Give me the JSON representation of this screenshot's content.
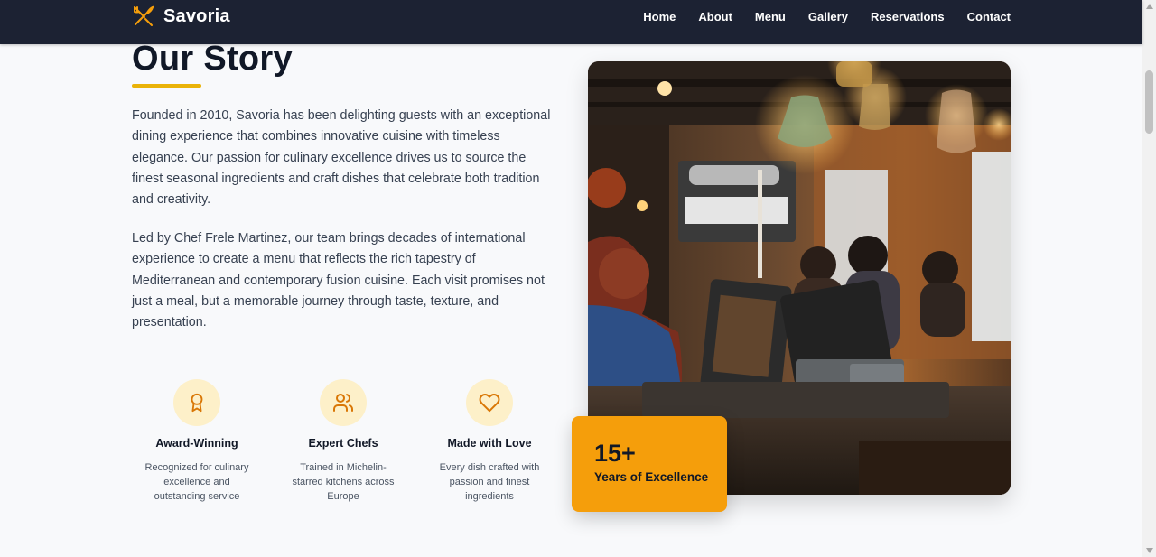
{
  "brand": {
    "name": "Savoria",
    "logo_icon": "utensils-crossed-icon",
    "accent_color": "#f59e0b"
  },
  "nav": {
    "links": [
      "Home",
      "About",
      "Menu",
      "Gallery",
      "Reservations",
      "Contact"
    ]
  },
  "story": {
    "title": "Our Story",
    "paragraphs": [
      "Founded in 2010, Savoria has been delighting guests with an exceptional dining experience that combines innovative cuisine with timeless elegance. Our passion for culinary excellence drives us to source the finest seasonal ingredients and craft dishes that celebrate both tradition and creativity.",
      "Led by Chef Frele Martinez, our team brings decades of international experience to create a menu that reflects the rich tapestry of Mediterranean and contemporary fusion cuisine. Each visit promises not just a meal, but a memorable journey through taste, texture, and presentation."
    ]
  },
  "features": [
    {
      "icon": "award-icon",
      "title": "Award-Winning",
      "description": "Recognized for culinary excellence and outstanding service"
    },
    {
      "icon": "users-icon",
      "title": "Expert Chefs",
      "description": "Trained in Michelin-starred kitchens across Europe"
    },
    {
      "icon": "heart-icon",
      "title": "Made with Love",
      "description": "Every dish crafted with passion and finest ingredients"
    }
  ],
  "badge": {
    "number": "15+",
    "label": "Years of Excellence"
  },
  "colors": {
    "nav_bg": "#1c2233",
    "accent": "#f59e0b",
    "icon_bg": "#fdf0c9",
    "underline": "#eab308"
  }
}
